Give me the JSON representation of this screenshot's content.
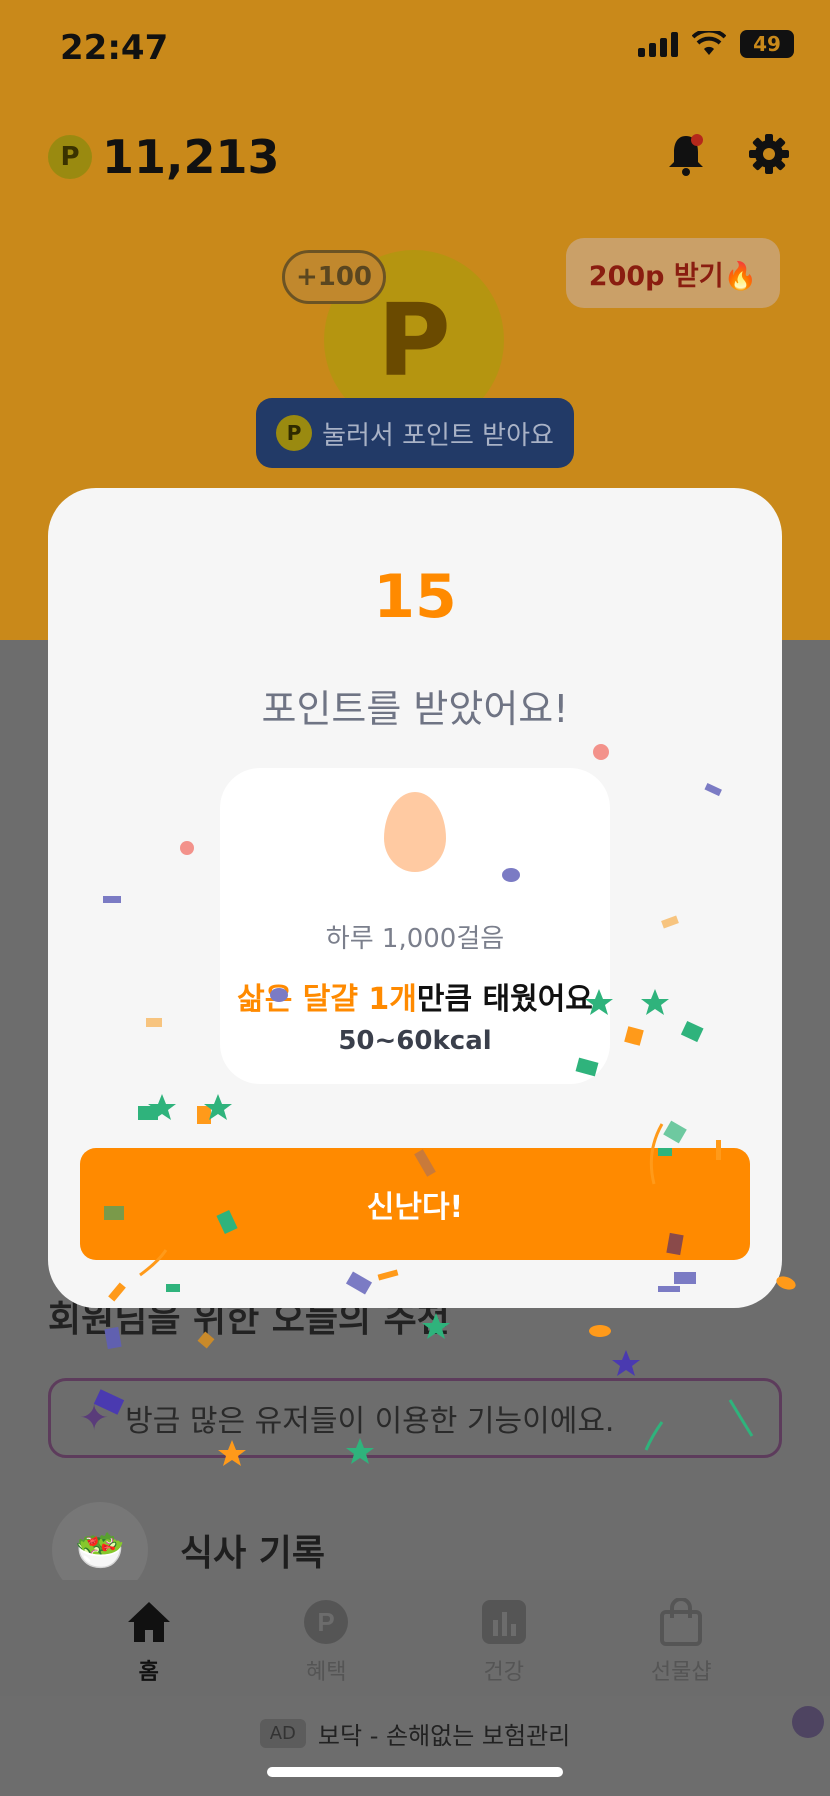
{
  "status_bar": {
    "time": "22:47",
    "battery": "49"
  },
  "header": {
    "points_icon": "P",
    "points": "11,213"
  },
  "hero": {
    "plus_badge": "+100",
    "bonus_button": "200p 받기🔥",
    "coin_letter": "P",
    "press_label": "눌러서 포인트 받아요",
    "press_icon": "P"
  },
  "recommend": {
    "title": "회원님을 위한 오늘의 추천",
    "banner": "방금 많은 유저들이 이용한 기능이에요.",
    "meal_label": "식사 기록"
  },
  "tabs": [
    {
      "label": "홈",
      "icon": "home-icon"
    },
    {
      "label": "혜택",
      "icon": "points-icon"
    },
    {
      "label": "건강",
      "icon": "chart-icon"
    },
    {
      "label": "선물샵",
      "icon": "shopping-bag-icon"
    }
  ],
  "ad": {
    "tag": "AD",
    "text": "보닥 - 손해없는 보험관리"
  },
  "modal": {
    "points": "15",
    "title": "포인트를 받았어요!",
    "steps": "하루 1,000걸음",
    "burn_highlight": "삶은 달걀 1개",
    "burn_rest": "만큼 태웠어요",
    "kcal": "50~60kcal",
    "confirm": "신난다!"
  },
  "colors": {
    "accent": "#ff8a00",
    "egg": "#ffcaa2"
  }
}
